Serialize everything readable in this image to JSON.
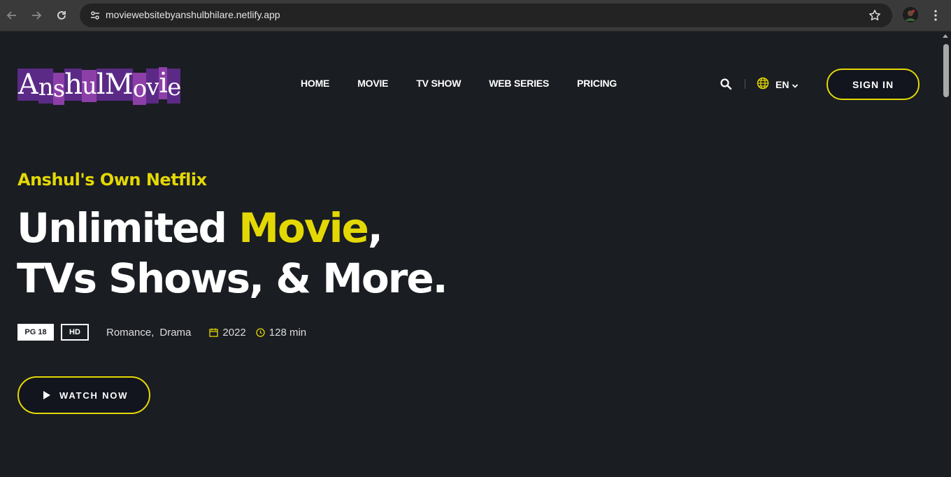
{
  "browser": {
    "url": "moviewebsitebyanshulbhilare.netlify.app",
    "icons": [
      "back-arrow-icon",
      "forward-arrow-icon",
      "reload-icon",
      "site-settings-icon",
      "star-icon",
      "profile-avatar",
      "menu-dots-icon"
    ]
  },
  "header": {
    "logo": [
      "A",
      "n",
      "s",
      "h",
      "u",
      "l",
      "M",
      "o",
      "v",
      "i",
      "e"
    ],
    "nav": [
      "HOME",
      "MOVIE",
      "TV SHOW",
      "WEB SERIES",
      "PRICING"
    ],
    "lang": "EN",
    "sign_in": "SIGN IN"
  },
  "hero": {
    "tagline": "Anshul's Own Netflix",
    "headline_part1": "Unlimited ",
    "headline_highlight": "Movie",
    "headline_part2": ",",
    "headline_line2": "TVs Shows, & More.",
    "rating": "PG 18",
    "quality": "HD",
    "genre1": "Romance,",
    "genre2": "Drama",
    "year": "2022",
    "duration": "128 min",
    "watch_label": "WATCH NOW"
  },
  "colors": {
    "accent": "#e4d804",
    "background": "#1a1d22",
    "logo_purple": "#5b2a86",
    "logo_violet": "#8d3fa8"
  }
}
